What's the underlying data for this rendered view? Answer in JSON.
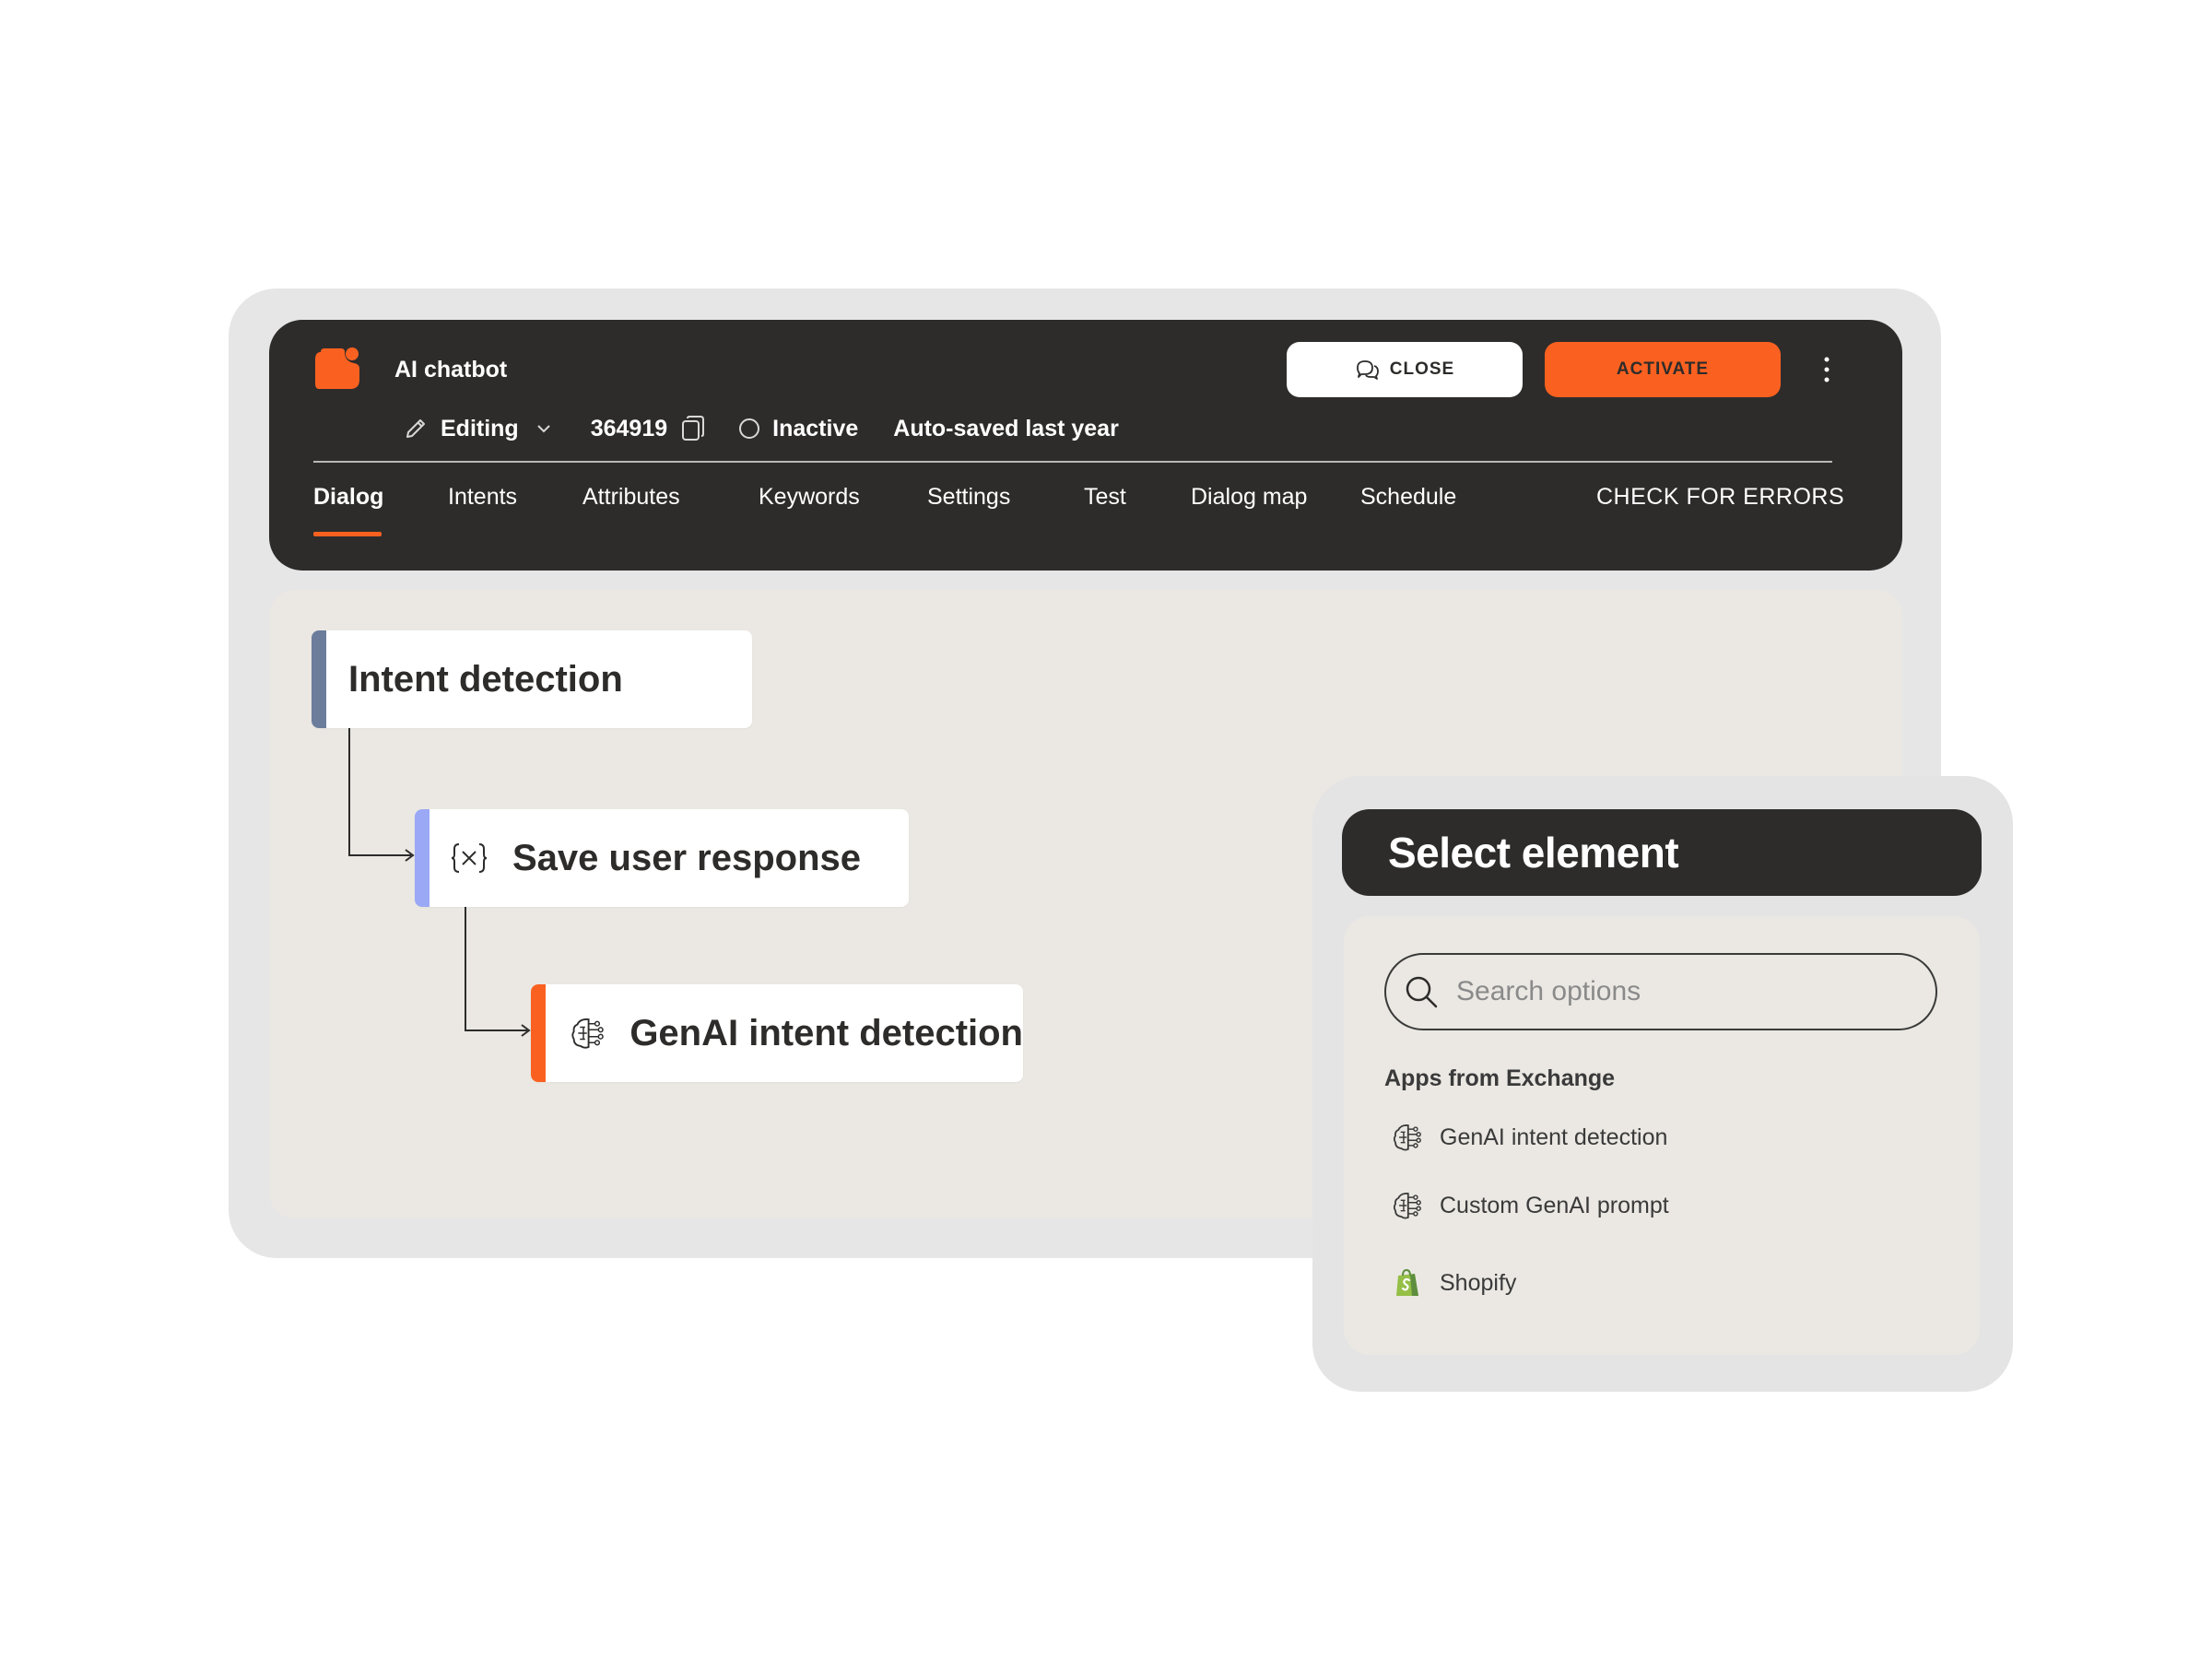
{
  "header": {
    "app_title": "AI chatbot",
    "mode_label": "Editing",
    "bot_id": "364919",
    "status_label": "Inactive",
    "autosave_text": "Auto-saved last year",
    "close_label": "CLOSE",
    "activate_label": "ACTIVATE",
    "check_errors_label": "CHECK FOR ERRORS"
  },
  "tabs": [
    {
      "label": "Dialog",
      "active": true
    },
    {
      "label": "Intents"
    },
    {
      "label": "Attributes"
    },
    {
      "label": "Keywords"
    },
    {
      "label": "Settings"
    },
    {
      "label": "Test"
    },
    {
      "label": "Dialog map"
    },
    {
      "label": "Schedule"
    }
  ],
  "flow": {
    "nodes": [
      {
        "label": "Intent detection",
        "accent": "#6c7d9c"
      },
      {
        "label": "Save user response",
        "accent": "#9aa8f5",
        "icon": "variable-icon"
      },
      {
        "label": "GenAI intent detection",
        "accent": "#fa6120",
        "icon": "ai-brain-icon"
      }
    ]
  },
  "select_panel": {
    "title": "Select element",
    "search_placeholder": "Search options",
    "section_title": "Apps from Exchange",
    "options": [
      {
        "label": "GenAI intent detection",
        "icon": "ai-brain-icon"
      },
      {
        "label": "Custom GenAI prompt",
        "icon": "ai-brain-icon"
      },
      {
        "label": "Shopify",
        "icon": "shopify-icon"
      }
    ]
  },
  "colors": {
    "brand": "#fa6120",
    "dark": "#2d2c2b",
    "canvas": "#ebe8e3"
  }
}
